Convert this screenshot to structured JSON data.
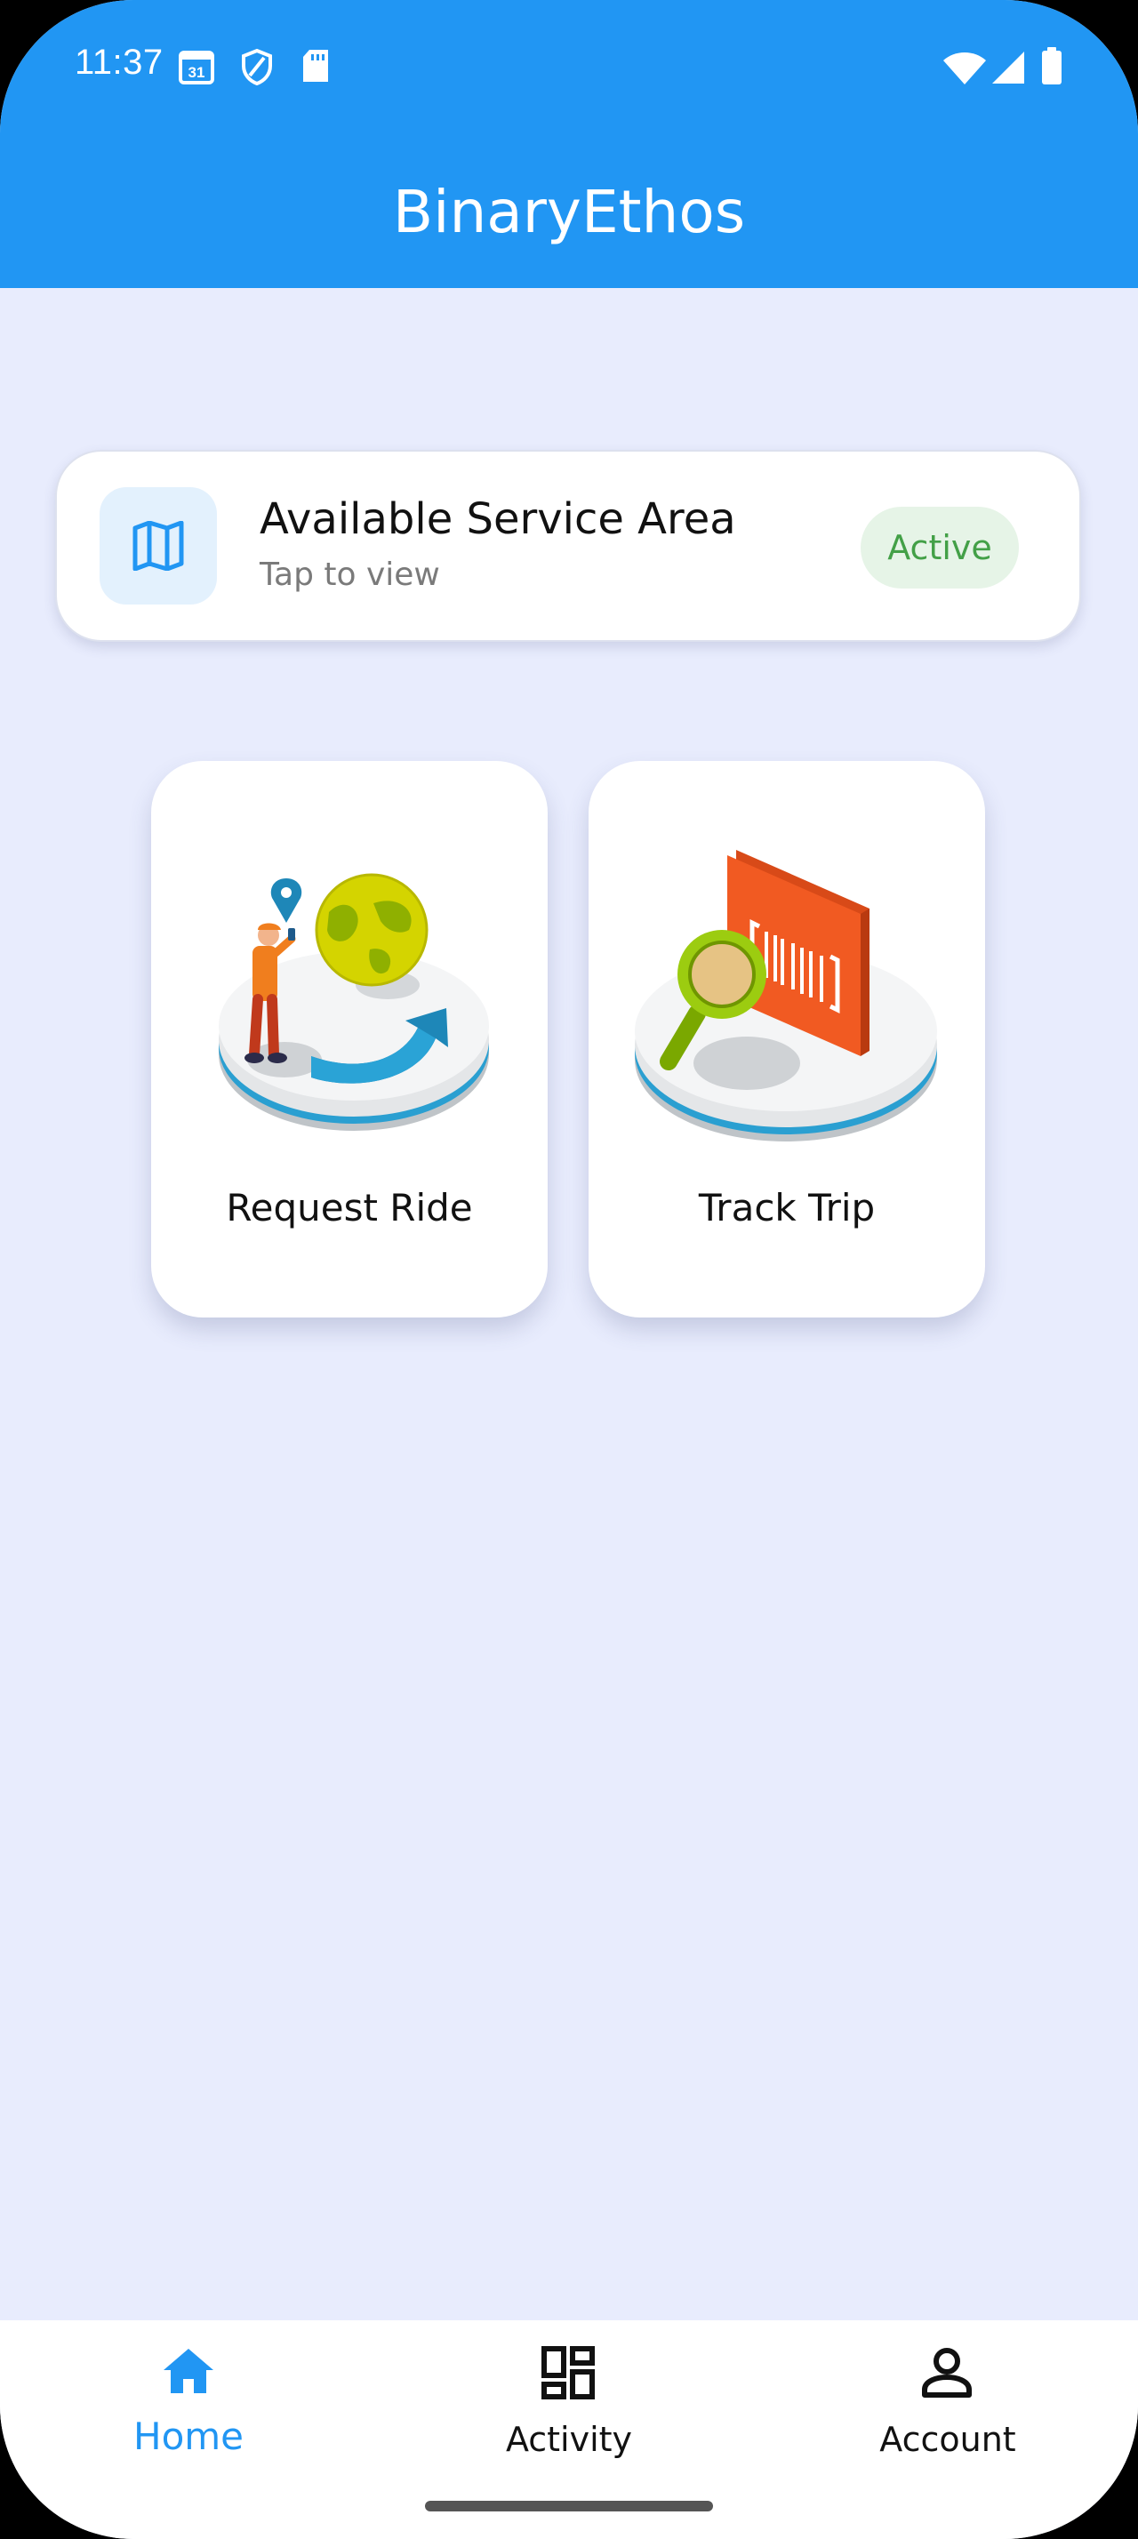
{
  "status_bar": {
    "time": "11:37",
    "icons": [
      "calendar-icon",
      "shield-icon",
      "sd-card-icon",
      "wifi-icon",
      "signal-icon",
      "battery-icon"
    ]
  },
  "app": {
    "title": "BinaryEthos",
    "header_color": "#2196f3",
    "background_color": "#e8ecfd"
  },
  "service_card": {
    "title": "Available Service Area",
    "subtitle": "Tap to view",
    "icon": "map-icon",
    "badge": "Active",
    "badge_color": "#43a047"
  },
  "tiles": [
    {
      "label": "Request Ride",
      "icon": "request-ride-illustration"
    },
    {
      "label": "Track Trip",
      "icon": "track-trip-illustration"
    }
  ],
  "bottom_nav": {
    "selected": "Home",
    "selected_color": "#2196f3",
    "items": [
      {
        "label": "Home",
        "icon": "home-icon"
      },
      {
        "label": "Activity",
        "icon": "dashboard-icon"
      },
      {
        "label": "Account",
        "icon": "person-icon"
      }
    ]
  }
}
